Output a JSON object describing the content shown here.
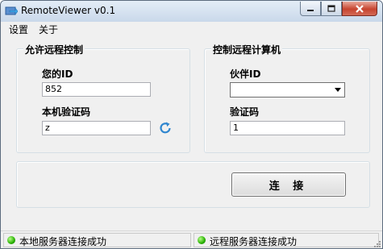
{
  "window": {
    "title": "RemoteViewer v0.1"
  },
  "menu": {
    "items": [
      "设置",
      "关于"
    ]
  },
  "allow_group": {
    "title": "允许远程控制",
    "id_label": "您的ID",
    "id_value": "852",
    "code_label": "本机验证码",
    "code_value": "z"
  },
  "control_group": {
    "title": "控制远程计算机",
    "partner_label": "伙伴ID",
    "partner_value": "",
    "code_label": "验证码",
    "code_value": "1"
  },
  "connect_button": "连 接",
  "status": {
    "local": "本地服务器连接成功",
    "remote": "远程服务器连接成功",
    "led_color": "#27b000"
  },
  "icons": {
    "app": "remote-arrow-icon",
    "refresh": "refresh-icon",
    "dropdown": "chevron-down-icon"
  }
}
